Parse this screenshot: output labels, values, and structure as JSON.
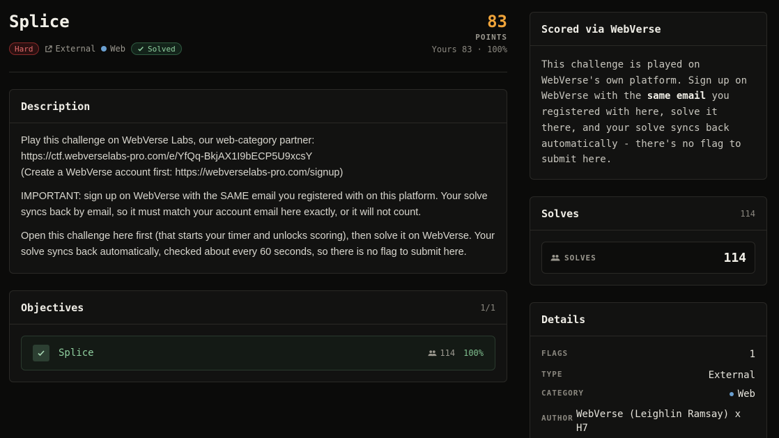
{
  "challenge": {
    "title": "Splice",
    "difficulty": "Hard",
    "kind": "External",
    "category": "Web",
    "status": "Solved",
    "points": "83",
    "points_label": "POINTS",
    "yours": "Yours 83 · 100%"
  },
  "description": {
    "heading": "Description",
    "line1": "Play this challenge on WebVerse Labs, our web-category partner:",
    "line2": "https://ctf.webverselabs-pro.com/e/YfQq-BkjAX1I9bECP5U9xcsY",
    "line3": "(Create a WebVerse account first: https://webverselabs-pro.com/signup)",
    "para2": "IMPORTANT: sign up on WebVerse with the SAME email you registered with on this platform. Your solve syncs back by email, so it must match your account email here exactly, or it will not count.",
    "para3": "Open this challenge here first (that starts your timer and unlocks scoring), then solve it on WebVerse. Your solve syncs back automatically, checked about every 60 seconds, so there is no flag to submit here."
  },
  "objectives": {
    "heading": "Objectives",
    "count": "1/1",
    "items": [
      {
        "name": "Splice",
        "solves": "114",
        "percent": "100%"
      }
    ]
  },
  "scored": {
    "heading": "Scored via WebVerse",
    "text_before": "This challenge is played on WebVerse's own platform. Sign up on WebVerse with the ",
    "emphasis": "same email",
    "text_after": " you registered with here, solve it there, and your solve syncs back automatically - there's no flag to submit here."
  },
  "solves": {
    "heading": "Solves",
    "count": "114",
    "label": "SOLVES",
    "value": "114"
  },
  "details": {
    "heading": "Details",
    "flags_label": "FLAGS",
    "flags_value": "1",
    "type_label": "TYPE",
    "type_value": "External",
    "category_label": "CATEGORY",
    "category_value": "Web",
    "author_label": "AUTHOR",
    "author_value": "WebVerse (Leighlin Ramsay) x H7"
  },
  "colors": {
    "accent_points": "#f0a43a",
    "hard": "#e06a6a",
    "solved": "#8fcf9f",
    "web_dot": "#6a9fd0"
  },
  "icons": [
    "external-link-icon",
    "check-icon",
    "users-icon"
  ]
}
